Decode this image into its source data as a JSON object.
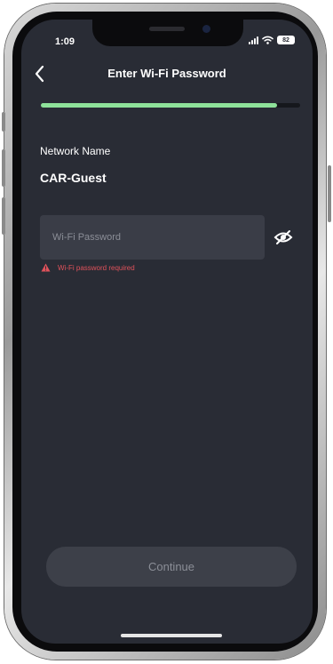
{
  "status_bar": {
    "time": "1:09",
    "battery": "82"
  },
  "header": {
    "title": "Enter Wi-Fi Password"
  },
  "progress": {
    "value": 0.91,
    "color": "#8ee29a"
  },
  "network": {
    "label": "Network Name",
    "name": "CAR-Guest"
  },
  "password": {
    "placeholder": "Wi-Fi Password",
    "value": ""
  },
  "error": {
    "message": "Wi-Fi password required",
    "color": "#e0525b"
  },
  "actions": {
    "continue_label": "Continue"
  },
  "icons": {
    "back": "chevron-left-icon",
    "visibility": "eye-slash-icon",
    "warning": "warning-triangle-icon",
    "signal": "signal-icon",
    "wifi": "wifi-icon",
    "battery": "battery-icon"
  },
  "colors": {
    "screen_background": "#292c35",
    "input_background": "#3a3d47",
    "button_background": "#3d4049"
  }
}
